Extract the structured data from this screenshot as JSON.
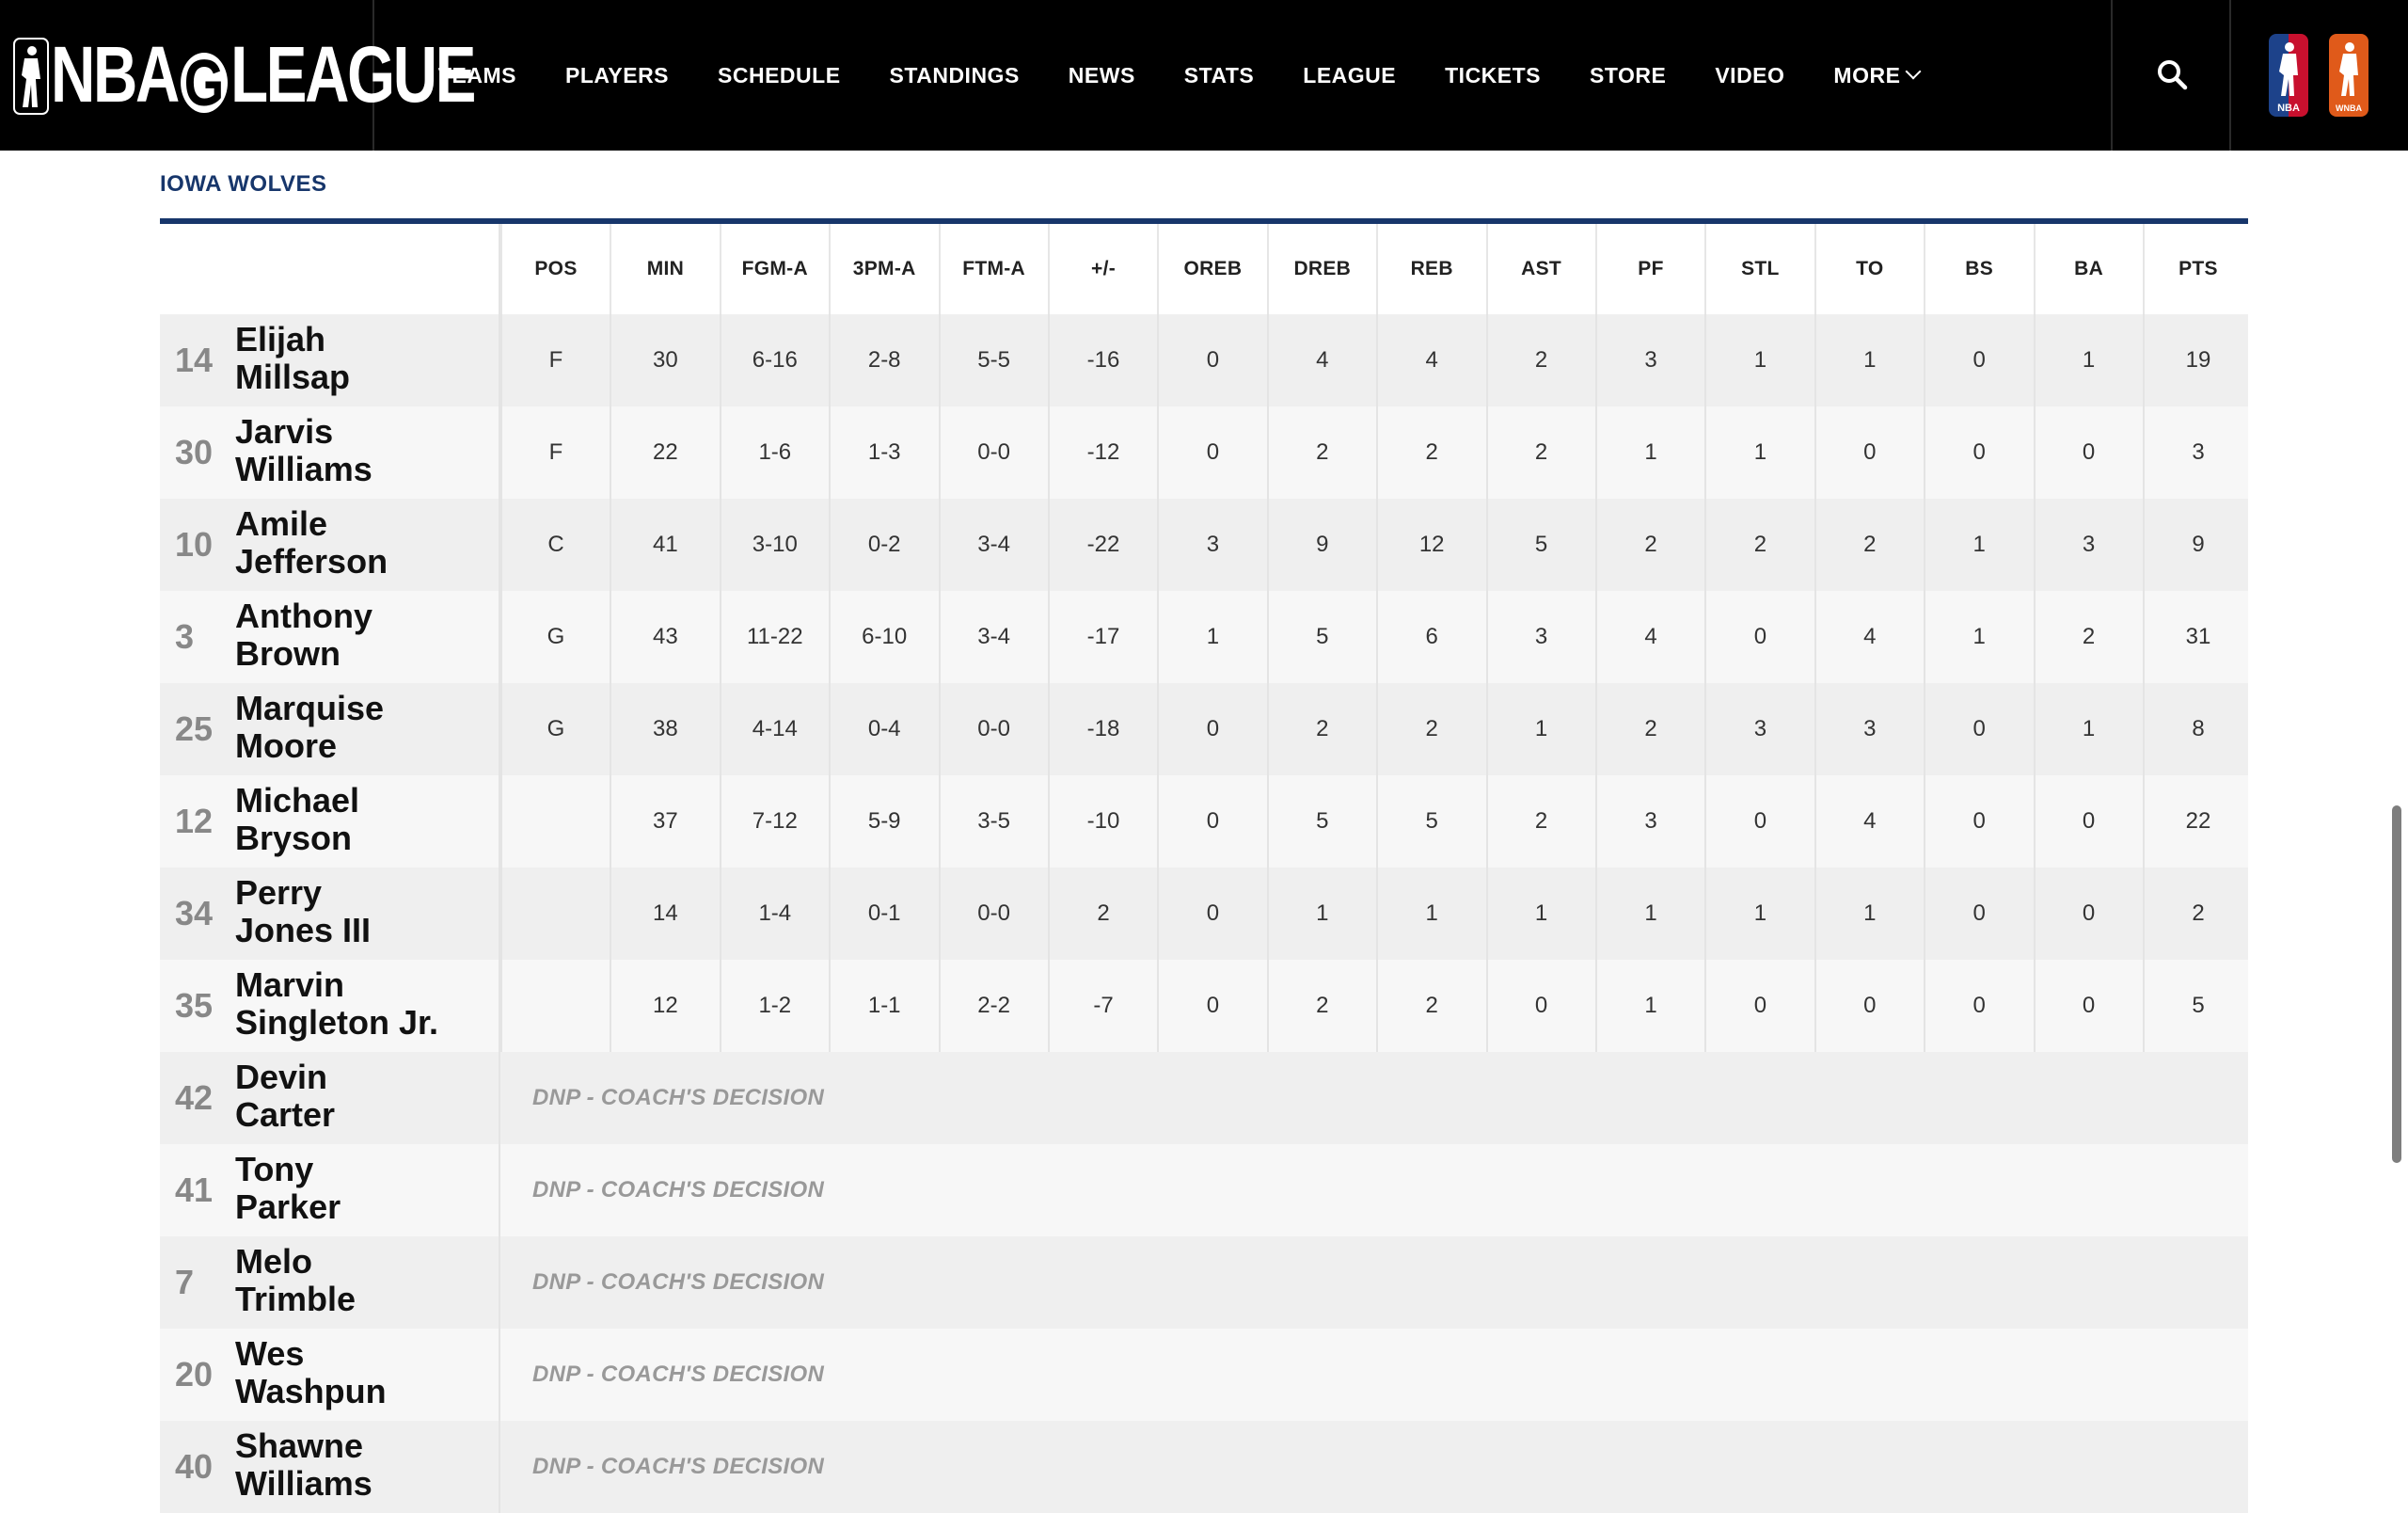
{
  "header": {
    "logo_text_left": "NBA",
    "logo_text_g": "G",
    "logo_text_right": "LEAGUE",
    "nav": [
      {
        "label": "TEAMS"
      },
      {
        "label": "PLAYERS"
      },
      {
        "label": "SCHEDULE"
      },
      {
        "label": "STANDINGS"
      },
      {
        "label": "NEWS"
      },
      {
        "label": "STATS"
      },
      {
        "label": "LEAGUE"
      },
      {
        "label": "TICKETS"
      },
      {
        "label": "STORE"
      },
      {
        "label": "VIDEO"
      },
      {
        "label": "MORE"
      }
    ],
    "brand_nba_label": "NBA",
    "brand_wnba_label": "WNBA"
  },
  "team": {
    "name": "IOWA WOLVES"
  },
  "columns": [
    "POS",
    "MIN",
    "FGM-A",
    "3PM-A",
    "FTM-A",
    "+/-",
    "OREB",
    "DREB",
    "REB",
    "AST",
    "PF",
    "STL",
    "TO",
    "BS",
    "BA",
    "PTS"
  ],
  "players": [
    {
      "number": "14",
      "first": "Elijah",
      "last": "Millsap",
      "stats": [
        "F",
        "30",
        "6-16",
        "2-8",
        "5-5",
        "-16",
        "0",
        "4",
        "4",
        "2",
        "3",
        "1",
        "1",
        "0",
        "1",
        "19"
      ]
    },
    {
      "number": "30",
      "first": "Jarvis",
      "last": "Williams",
      "stats": [
        "F",
        "22",
        "1-6",
        "1-3",
        "0-0",
        "-12",
        "0",
        "2",
        "2",
        "2",
        "1",
        "1",
        "0",
        "0",
        "0",
        "3"
      ]
    },
    {
      "number": "10",
      "first": "Amile",
      "last": "Jefferson",
      "stats": [
        "C",
        "41",
        "3-10",
        "0-2",
        "3-4",
        "-22",
        "3",
        "9",
        "12",
        "5",
        "2",
        "2",
        "2",
        "1",
        "3",
        "9"
      ]
    },
    {
      "number": "3",
      "first": "Anthony",
      "last": "Brown",
      "stats": [
        "G",
        "43",
        "11-22",
        "6-10",
        "3-4",
        "-17",
        "1",
        "5",
        "6",
        "3",
        "4",
        "0",
        "4",
        "1",
        "2",
        "31"
      ]
    },
    {
      "number": "25",
      "first": "Marquise",
      "last": "Moore",
      "stats": [
        "G",
        "38",
        "4-14",
        "0-4",
        "0-0",
        "-18",
        "0",
        "2",
        "2",
        "1",
        "2",
        "3",
        "3",
        "0",
        "1",
        "8"
      ]
    },
    {
      "number": "12",
      "first": "Michael",
      "last": "Bryson",
      "stats": [
        "",
        "37",
        "7-12",
        "5-9",
        "3-5",
        "-10",
        "0",
        "5",
        "5",
        "2",
        "3",
        "0",
        "4",
        "0",
        "0",
        "22"
      ]
    },
    {
      "number": "34",
      "first": "Perry",
      "last": "Jones III",
      "stats": [
        "",
        "14",
        "1-4",
        "0-1",
        "0-0",
        "2",
        "0",
        "1",
        "1",
        "1",
        "1",
        "1",
        "1",
        "0",
        "0",
        "2"
      ]
    },
    {
      "number": "35",
      "first": "Marvin",
      "last": "Singleton Jr.",
      "stats": [
        "",
        "12",
        "1-2",
        "1-1",
        "2-2",
        "-7",
        "0",
        "2",
        "2",
        "0",
        "1",
        "0",
        "0",
        "0",
        "0",
        "5"
      ]
    },
    {
      "number": "42",
      "first": "Devin",
      "last": "Carter",
      "dnp": "DNP - COACH'S DECISION"
    },
    {
      "number": "41",
      "first": "Tony",
      "last": "Parker",
      "dnp": "DNP - COACH'S DECISION"
    },
    {
      "number": "7",
      "first": "Melo",
      "last": "Trimble",
      "dnp": "DNP - COACH'S DECISION"
    },
    {
      "number": "20",
      "first": "Wes",
      "last": "Washpun",
      "dnp": "DNP - COACH'S DECISION"
    },
    {
      "number": "40",
      "first": "Shawne",
      "last": "Williams",
      "dnp": "DNP - COACH'S DECISION"
    }
  ],
  "icons": {
    "search": "search-icon",
    "more_chevron": "chevron-down-icon"
  },
  "colors": {
    "header_bg": "#000000",
    "team_accent": "#17366b",
    "nba_blue": "#1d428a",
    "nba_red": "#c8102e",
    "wnba_orange": "#e05a1a"
  }
}
